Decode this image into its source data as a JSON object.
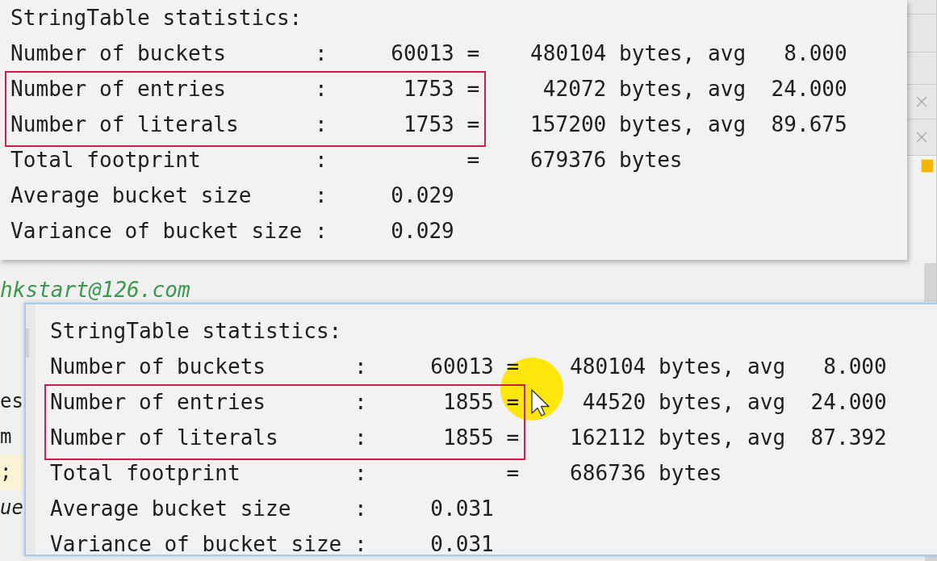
{
  "panels": [
    {
      "rows": [
        {
          "kind": "title",
          "label": "StringTable statistics:",
          "highlighted": false
        },
        {
          "kind": "stat",
          "label": "Number of buckets",
          "colon": ":",
          "count": "60013",
          "equals": "=",
          "bytes": "480104",
          "unit": "bytes, avg",
          "avg": "8.000",
          "highlighted": false
        },
        {
          "kind": "stat",
          "label": "Number of entries",
          "colon": ":",
          "count": "1753",
          "equals": "=",
          "bytes": "42072",
          "unit": "bytes, avg",
          "avg": "24.000",
          "highlighted": true
        },
        {
          "kind": "stat",
          "label": "Number of literals",
          "colon": ":",
          "count": "1753",
          "equals": "=",
          "bytes": "157200",
          "unit": "bytes, avg",
          "avg": "89.675",
          "highlighted": true
        },
        {
          "kind": "stat",
          "label": "Total footprint",
          "colon": ":",
          "equals": "=",
          "bytes": "679376",
          "unit": "bytes",
          "highlighted": false
        },
        {
          "kind": "stat",
          "label": "Average bucket size",
          "colon": ":",
          "count": "0.029",
          "highlighted": false
        },
        {
          "kind": "stat",
          "label": "Variance of bucket size",
          "colon": ":",
          "count": "0.029",
          "highlighted": false
        }
      ]
    },
    {
      "rows": [
        {
          "kind": "title",
          "label": "StringTable statistics:",
          "highlighted": false
        },
        {
          "kind": "stat",
          "label": "Number of buckets",
          "colon": ":",
          "count": "60013",
          "equals": "=",
          "bytes": "480104",
          "unit": "bytes, avg",
          "avg": "8.000",
          "highlighted": false
        },
        {
          "kind": "stat",
          "label": "Number of entries",
          "colon": ":",
          "count": "1855",
          "equals": "=",
          "bytes": "44520",
          "unit": "bytes, avg",
          "avg": "24.000",
          "highlighted": true
        },
        {
          "kind": "stat",
          "label": "Number of literals",
          "colon": ":",
          "count": "1855",
          "equals": "=",
          "bytes": "162112",
          "unit": "bytes, avg",
          "avg": "87.392",
          "highlighted": true
        },
        {
          "kind": "stat",
          "label": "Total footprint",
          "colon": ":",
          "equals": "=",
          "bytes": "686736",
          "unit": "bytes",
          "highlighted": false
        },
        {
          "kind": "stat",
          "label": "Average bucket size",
          "colon": ":",
          "count": "0.031",
          "highlighted": false
        },
        {
          "kind": "stat",
          "label": "Variance of bucket size",
          "colon": ":",
          "count": "0.031",
          "highlighted": false
        }
      ]
    }
  ],
  "side_tabs": [
    {
      "closable": false
    },
    {
      "closable": false
    },
    {
      "closable": false
    },
    {
      "closable": true
    },
    {
      "closable": true
    }
  ],
  "editor": {
    "lines": [
      {
        "text": "hkstart@126.com",
        "kind": "comment",
        "current": false
      },
      {
        "text": "es",
        "kind": "code",
        "current": false
      },
      {
        "text": "m",
        "kind": "code",
        "current": false
      },
      {
        "text": ";",
        "kind": "code",
        "current": true
      },
      {
        "text": "ue",
        "kind": "emphasis",
        "current": false
      }
    ]
  }
}
